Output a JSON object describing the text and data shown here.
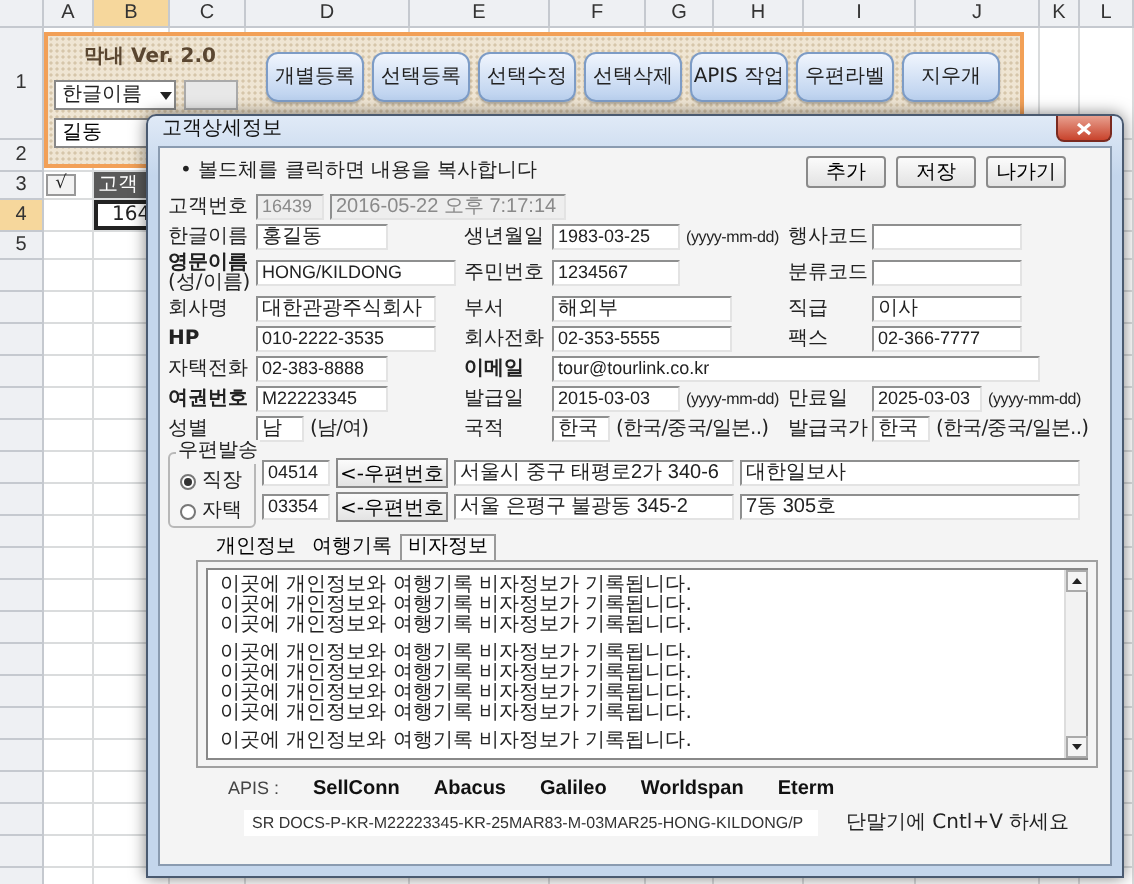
{
  "sheet": {
    "columns": [
      {
        "label": "A",
        "selected": false
      },
      {
        "label": "B",
        "selected": true
      },
      {
        "label": "C",
        "selected": false
      },
      {
        "label": "D",
        "selected": false
      },
      {
        "label": "E",
        "selected": false
      },
      {
        "label": "F",
        "selected": false
      },
      {
        "label": "G",
        "selected": false
      },
      {
        "label": "H",
        "selected": false
      },
      {
        "label": "I",
        "selected": false
      },
      {
        "label": "J",
        "selected": false
      },
      {
        "label": "K",
        "selected": false
      },
      {
        "label": "L",
        "selected": false
      }
    ],
    "rows": [
      {
        "label": "1",
        "selected": false
      },
      {
        "label": "2",
        "selected": false
      },
      {
        "label": "3",
        "selected": false,
        "cells": [
          {
            "kind": "check",
            "text": "√"
          },
          {
            "kind": "header",
            "text": "고객"
          }
        ]
      },
      {
        "label": "4",
        "selected": true,
        "cells": [
          {
            "kind": "empty"
          },
          {
            "kind": "value",
            "text": "164",
            "selected": true
          }
        ]
      },
      {
        "label": "5",
        "selected": false
      }
    ]
  },
  "panel": {
    "version": "막내 Ver. 2.0",
    "dropdown": {
      "value": "한글이름"
    },
    "search_input": {
      "value": "길동"
    },
    "buttons": [
      "개별등록",
      "선택등록",
      "선택수정",
      "선택삭제",
      "APIS 작업",
      "우편라벨",
      "지우개"
    ]
  },
  "dialog": {
    "title": "고객상세정보",
    "note": "• 볼드체를 클릭하면 내용을 복사합니다",
    "buttons": [
      "추가",
      "저장",
      "나가기"
    ],
    "customer_no": {
      "label": "고객번호",
      "value": "16439",
      "timestamp": "2016-05-22 오후 7:17:14"
    },
    "form_rows": [
      [
        {
          "kind": "text",
          "label": "한글이름",
          "bold": false,
          "value": "홍길동"
        },
        {
          "kind": "text",
          "label": "생년월일",
          "bold": false,
          "value": "1983-03-25",
          "hint": "(yyyy-mm-dd)"
        },
        {
          "kind": "text",
          "label": "행사코드",
          "bold": false
        }
      ],
      [
        {
          "kind": "text",
          "label": "영문이름",
          "bold": true,
          "note": "(성/이름)",
          "value": "HONG/KILDONG"
        },
        {
          "kind": "text",
          "label": "주민번호",
          "bold": false,
          "value": "1234567"
        },
        {
          "kind": "text",
          "label": "분류코드",
          "bold": false
        }
      ],
      [
        {
          "kind": "text",
          "label": "회사명",
          "bold": false,
          "value": "대한관광주식회사"
        },
        {
          "kind": "text",
          "label": "부서",
          "bold": false,
          "value": "해외부"
        },
        {
          "kind": "text",
          "label": "직급",
          "bold": false,
          "value": "이사"
        }
      ],
      [
        {
          "kind": "text",
          "label": "HP",
          "bold": true,
          "value": "010-2222-3535"
        },
        {
          "kind": "text",
          "label": "회사전화",
          "bold": false,
          "value": "02-353-5555"
        },
        {
          "kind": "text",
          "label": "팩스",
          "bold": false,
          "value": "02-366-7777"
        }
      ],
      [
        {
          "kind": "text",
          "label": "자택전화",
          "bold": false,
          "value": "02-383-8888"
        },
        {
          "kind": "wide",
          "label": "이메일",
          "bold": true,
          "value": "tour@tourlink.co.kr"
        }
      ],
      [
        {
          "kind": "text",
          "label": "여권번호",
          "bold": true,
          "value": "M22223345"
        },
        {
          "kind": "text",
          "label": "발급일",
          "bold": false,
          "value": "2015-03-03",
          "hint": "(yyyy-mm-dd)"
        },
        {
          "kind": "text",
          "label": "만료일",
          "bold": false,
          "value": "2025-03-03",
          "hint": "(yyyy-mm-dd)"
        }
      ],
      [
        {
          "kind": "text",
          "label": "성별",
          "bold": false,
          "value": "남",
          "hint": "(남/여)"
        },
        {
          "kind": "text",
          "label": "국적",
          "bold": false,
          "value": "한국",
          "hint": "(한국/중국/일본..)"
        },
        {
          "kind": "text",
          "label": "발급국가",
          "bold": false,
          "value": "한국",
          "hint": "(한국/중국/일본..)"
        }
      ]
    ],
    "postal": {
      "legend": "우편발송",
      "options": [
        {
          "label": "직장",
          "selected": true,
          "code": "04514",
          "button": "<-우편번호",
          "address": "서울시 중구 태평로2가 340-6",
          "detail": "대한일보사"
        },
        {
          "label": "자택",
          "selected": false,
          "code": "03354",
          "button": "<-우편번호",
          "address": "서울 은평구 불광동 345-2",
          "detail": "7동 305호"
        }
      ]
    },
    "tabs": [
      {
        "label": "개인정보",
        "selected": false
      },
      {
        "label": "여행기록",
        "selected": false
      },
      {
        "label": "비자정보",
        "selected": true
      }
    ],
    "records": [
      [
        "이곳에 개인정보와 여행기록 비자정보가 기록됩니다.",
        "이곳에 개인정보와 여행기록 비자정보가 기록됩니다.",
        "이곳에 개인정보와 여행기록 비자정보가 기록됩니다."
      ],
      [
        "이곳에 개인정보와 여행기록 비자정보가 기록됩니다.",
        "이곳에 개인정보와 여행기록 비자정보가 기록됩니다.",
        "이곳에 개인정보와 여행기록 비자정보가 기록됩니다.",
        "이곳에 개인정보와 여행기록 비자정보가 기록됩니다."
      ],
      [
        "이곳에 개인정보와 여행기록 비자정보가 기록됩니다."
      ]
    ],
    "apis": {
      "label": "APIS :",
      "links": [
        "SellConn",
        "Abacus",
        "Galileo",
        "Worldspan",
        "Eterm"
      ]
    },
    "docs": {
      "value": "SR DOCS-P-KR-M22223345-KR-25MAR83-M-03MAR25-HONG-KILDONG/P",
      "hint": "단말기에 Cntl+V 하세요"
    }
  }
}
